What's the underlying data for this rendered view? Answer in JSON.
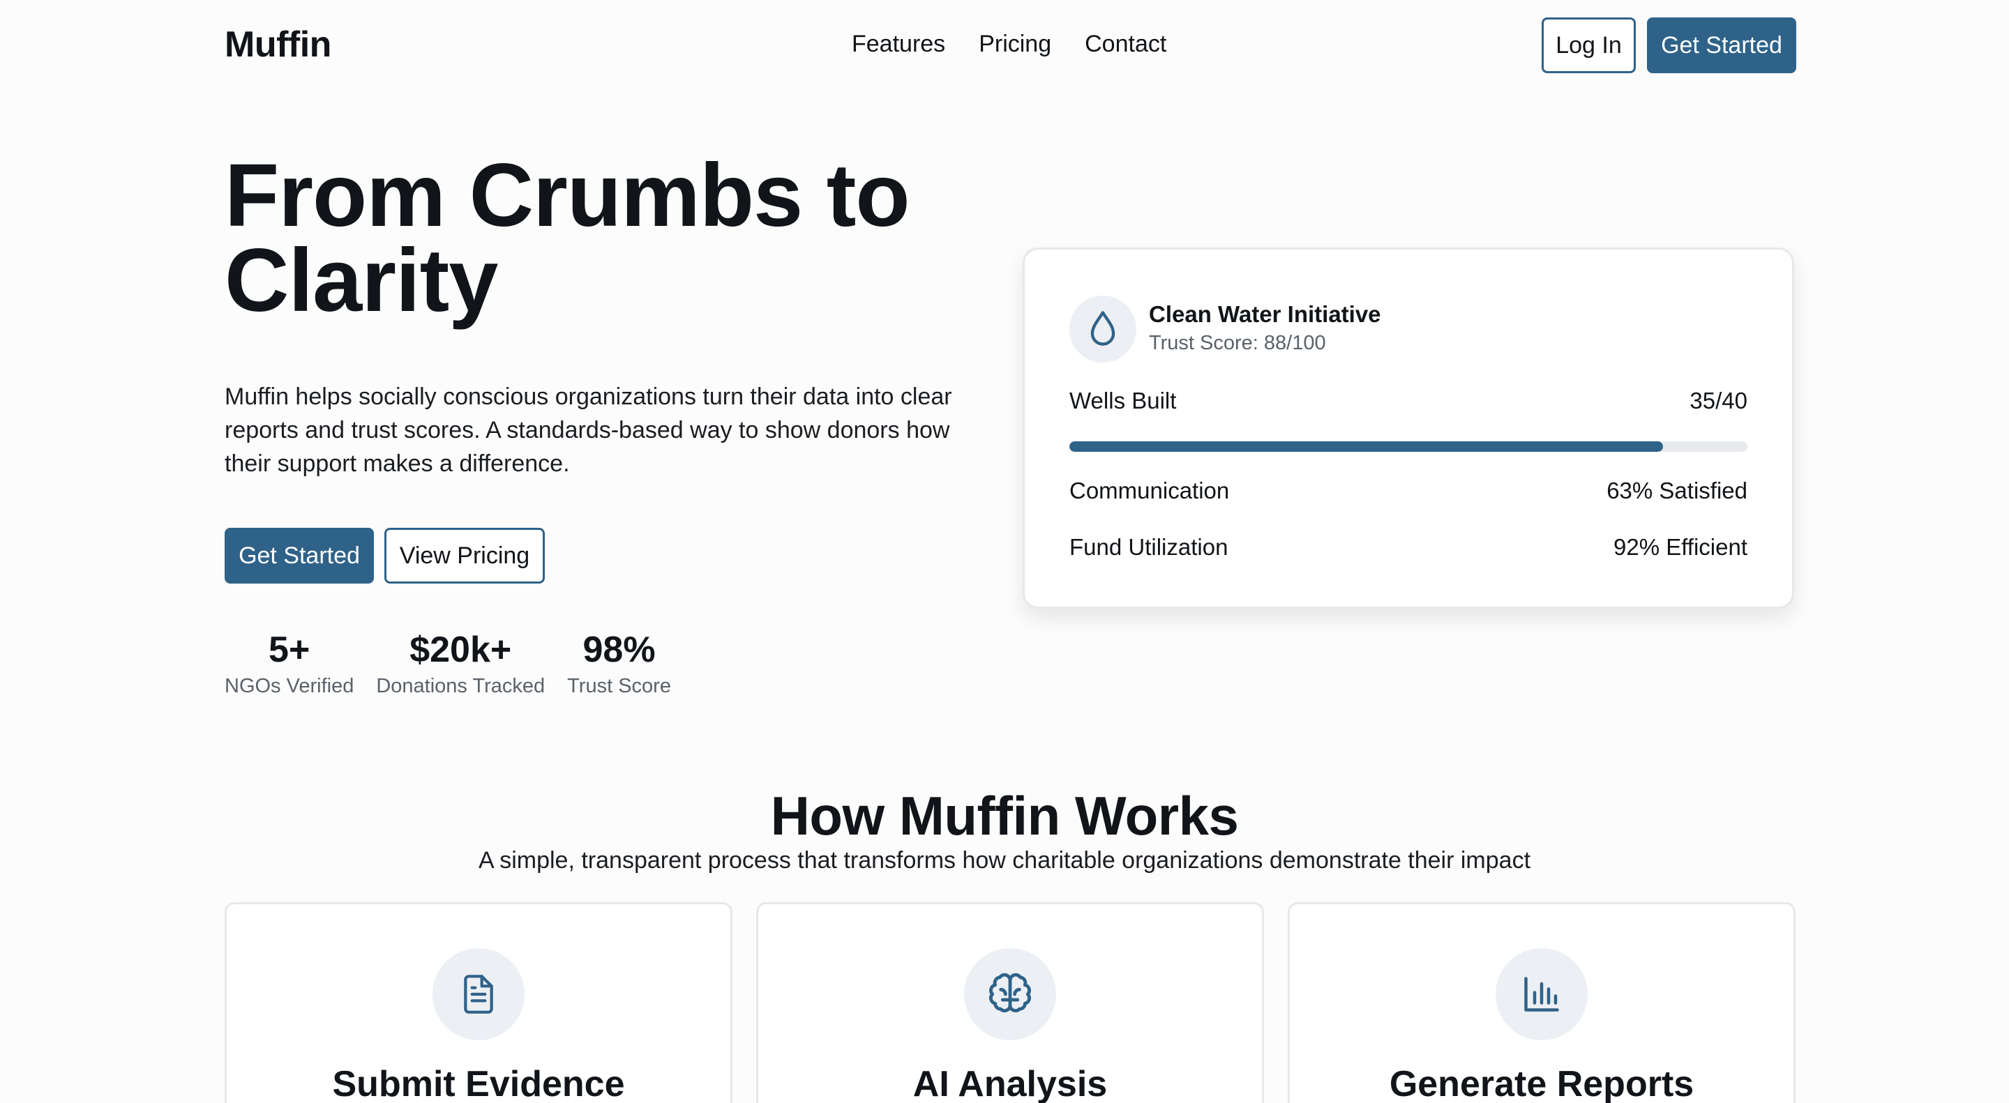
{
  "header": {
    "brand": "Muffin",
    "nav": [
      "Features",
      "Pricing",
      "Contact"
    ],
    "login_label": "Log In",
    "get_started_label": "Get Started"
  },
  "hero": {
    "title": "From Crumbs to Clarity",
    "description": "Muffin helps socially conscious organizations turn their data into clear reports and trust scores. A standards-based way to show donors how their support makes a difference.",
    "primary_cta": "Get Started",
    "secondary_cta": "View Pricing",
    "stats": [
      {
        "value": "5+",
        "label": "NGOs Verified"
      },
      {
        "value": "$20k+",
        "label": "Donations Tracked"
      },
      {
        "value": "98%",
        "label": "Trust Score"
      }
    ]
  },
  "card": {
    "icon": "water-drop-icon",
    "title": "Clean Water Initiative",
    "subtitle": "Trust Score: 88/100",
    "wells_label": "Wells Built",
    "wells_value": "35/40",
    "wells_progress": 0.875,
    "communication_label": "Communication",
    "communication_value": "63% Satisfied",
    "fund_label": "Fund Utilization",
    "fund_value": "92% Efficient"
  },
  "how": {
    "title": "How Muffin Works",
    "subtitle": "A simple, transparent process that transforms how charitable organizations demonstrate their impact",
    "features": [
      {
        "title": "Submit Evidence",
        "icon": "document-icon"
      },
      {
        "title": "AI Analysis",
        "icon": "brain-icon"
      },
      {
        "title": "Generate Reports",
        "icon": "bar-chart-icon"
      }
    ]
  },
  "colors": {
    "accent": "#2f6289",
    "text": "#111418",
    "muted": "#5b6169",
    "icon_bg": "#eceff3"
  }
}
